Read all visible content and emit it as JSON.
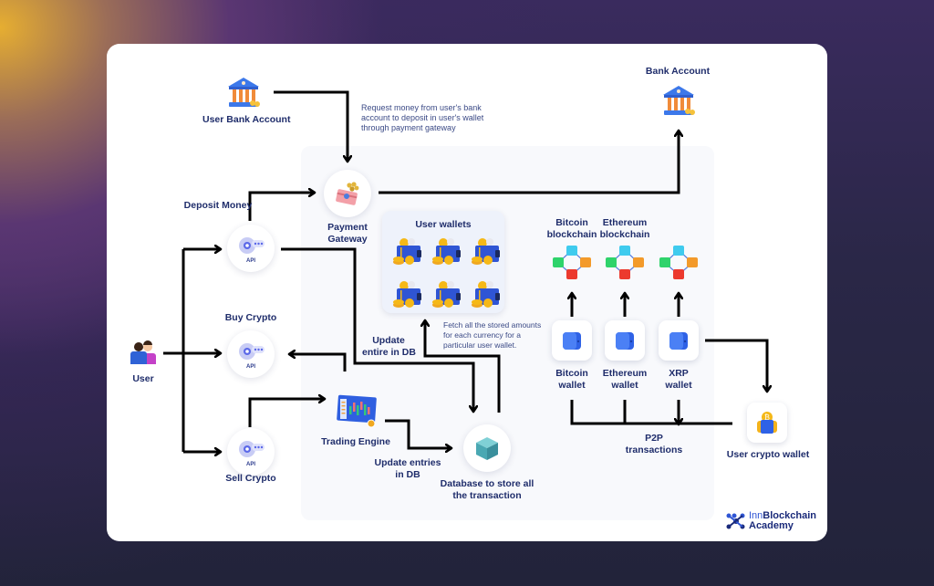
{
  "nodes": {
    "user_bank_account": "User Bank Account",
    "bank_account": "Bank Account",
    "payment_gateway": "Payment\nGateway",
    "payment_gateway_l1": "Payment",
    "payment_gateway_l2": "Gateway",
    "user": "User",
    "deposit_money": "Deposit Money",
    "buy_crypto": "Buy Crypto",
    "sell_crypto": "Sell Crypto",
    "api_label": "API",
    "trading_engine": "Trading Engine",
    "user_wallets": "User wallets",
    "database_l1": "Database to store all",
    "database_l2": "the transaction",
    "bitcoin_blockchain_l1": "Bitcoin",
    "bitcoin_blockchain_l2": "blockchain",
    "ethereum_blockchain_l1": "Ethereum",
    "ethereum_blockchain_l2": "blockchain",
    "bitcoin_wallet_l1": "Bitcoin",
    "bitcoin_wallet_l2": "wallet",
    "ethereum_wallet_l1": "Ethereum",
    "ethereum_wallet_l2": "wallet",
    "xrp_wallet_l1": "XRP",
    "xrp_wallet_l2": "wallet",
    "user_crypto_wallet": "User crypto wallet"
  },
  "annotations": {
    "request_money_l1": "Request money from user's bank",
    "request_money_l2": "account to deposit in user's wallet",
    "request_money_l3": "through payment gateway",
    "update_entire_l1": "Update",
    "update_entire_l2": "entire in DB",
    "update_entries_l1": "Update entries",
    "update_entries_l2": "in DB",
    "fetch_l1": "Fetch all the stored amounts",
    "fetch_l2": "for each currency for a",
    "fetch_l3": "particular user wallet.",
    "p2p_l1": "P2P",
    "p2p_l2": "transactions"
  },
  "branding": {
    "logo_inn": "Inn",
    "logo_blockchain": "Blockchain",
    "logo_academy": "Academy"
  },
  "colors": {
    "text_primary": "#1f2d6b",
    "arrow": "#000000",
    "panel": "#f8f9fc",
    "accent_blue": "#2f55d4"
  }
}
